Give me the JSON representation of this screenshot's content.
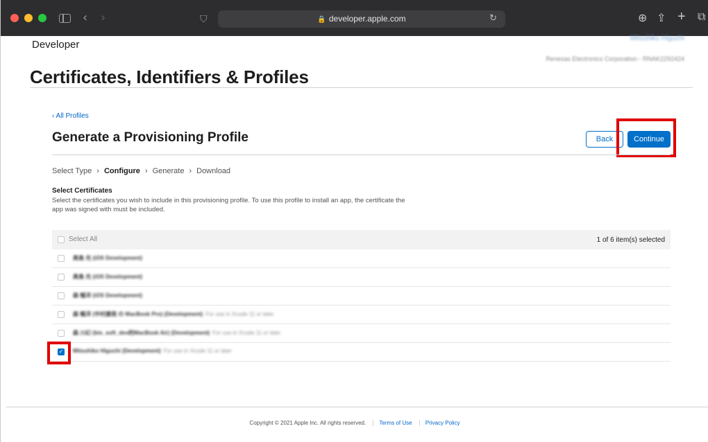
{
  "browser": {
    "url": "developer.apple.com",
    "icons": {
      "close": "#ff5f57",
      "minimize": "#febc2e",
      "zoom": "#28c840"
    }
  },
  "header": {
    "brand": "Developer",
    "account_name": "Mitsuhiko Higuchi",
    "account_org": "Renesas Electronics Corporation - RNAK2292424"
  },
  "page": {
    "title": "Certificates, Identifiers & Profiles",
    "breadcrumb": "‹ All Profiles",
    "section_title": "Generate a Provisioning Profile",
    "back_label": "Back",
    "continue_label": "Continue"
  },
  "steps": [
    {
      "label": "Select Type",
      "active": false
    },
    {
      "label": "Configure",
      "active": true
    },
    {
      "label": "Generate",
      "active": false
    },
    {
      "label": "Download",
      "active": false
    }
  ],
  "step_separator": "›",
  "certificates": {
    "title": "Select Certificates",
    "description": "Select the certificates you wish to include in this provisioning profile. To use this profile to install an app, the certificate the app was signed with must be included.",
    "select_all_label": "Select All",
    "selected_count": "1 of 6 item(s) selected",
    "items": [
      {
        "name": "高島 光 (iOS Development)",
        "note": "",
        "checked": false
      },
      {
        "name": "高島 光 (iOS Development)",
        "note": "",
        "checked": false
      },
      {
        "name": "森 暢洋 (iOS Development)",
        "note": "",
        "checked": false
      },
      {
        "name": "森 暢洋 (中村康晃 の MacBook Pro) (Development)",
        "note": "For use in Xcode 11 or later",
        "checked": false
      },
      {
        "name": "森 川幻 (bis_soft_dev的MacBook Air) (Development)",
        "note": "For use in Xcode 11 or later",
        "checked": false
      },
      {
        "name": "Mitsuhiko Higuchi (Development)",
        "note": "For use in Xcode 11 or later",
        "checked": true
      }
    ]
  },
  "footer": {
    "copyright": "Copyright © 2021 Apple Inc. All rights reserved.",
    "terms": "Terms of Use",
    "privacy": "Privacy Policy"
  },
  "colors": {
    "accent": "#0070c9",
    "highlight": "#e00000"
  }
}
